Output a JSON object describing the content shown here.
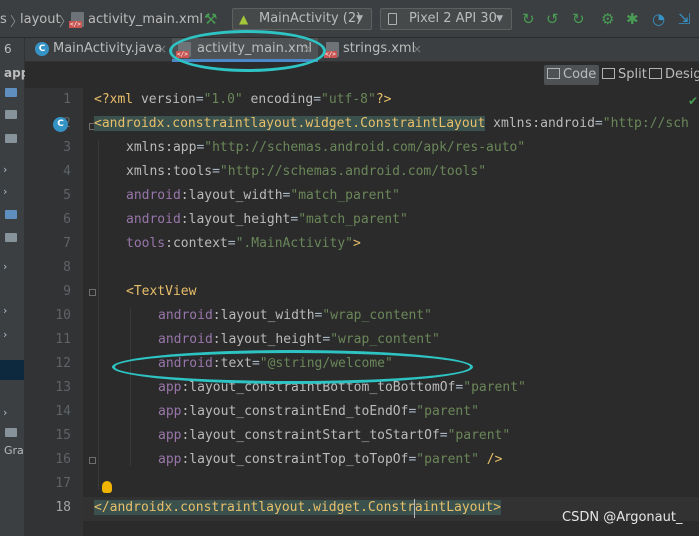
{
  "nav": {
    "crumb_left": "s",
    "crumb_layout": "layout",
    "crumb_file": "activity_main.xml",
    "run_config": "MainActivity (2)",
    "device": "Pixel 2 API 30"
  },
  "project_panel": {
    "top_label": "6",
    "root_label": "app",
    "gradle_label": "Gra"
  },
  "tabs": [
    {
      "label": "MainActivity.java",
      "close": "×"
    },
    {
      "label": "activity_main.xml",
      "close": "×"
    },
    {
      "label": "strings.xml",
      "close": "×"
    }
  ],
  "view_modes": {
    "code": "Code",
    "split": "Split",
    "design": "Desig"
  },
  "gutter": {
    "lines": [
      "1",
      "2",
      "3",
      "4",
      "5",
      "6",
      "7",
      "8",
      "9",
      "10",
      "11",
      "12",
      "13",
      "14",
      "15",
      "16",
      "17",
      "18"
    ],
    "class_marker": "C"
  },
  "code": {
    "l1_open": "<?xml ",
    "l1_a1": "version",
    "l1_eq1": "=",
    "l1_v1": "\"1.0\"",
    "l1_a2": " encoding",
    "l1_eq2": "=",
    "l1_v2": "\"utf-8\"",
    "l1_close": "?>",
    "l2_tag": "<androidx.constraintlayout.widget.ConstraintLayout",
    "l2_ns": " xmlns:android",
    "l2_eq": "=",
    "l2_val": "\"http://sch",
    "l3_ns": "xmlns:app",
    "l3_eq": "=",
    "l3_val": "\"http://schemas.android.com/apk/res-auto\"",
    "l4_ns": "xmlns:tools",
    "l4_eq": "=",
    "l4_val": "\"http://schemas.android.com/tools\"",
    "l5_ns": "android",
    "l5_attr": ":layout_width",
    "l5_eq": "=",
    "l5_val": "\"match_parent\"",
    "l6_ns": "android",
    "l6_attr": ":layout_height",
    "l6_eq": "=",
    "l6_val": "\"match_parent\"",
    "l7_ns": "tools",
    "l7_attr": ":context",
    "l7_eq": "=",
    "l7_val": "\".MainActivity\"",
    "l7_close": ">",
    "l9_tag": "<TextView",
    "l10_ns": "android",
    "l10_attr": ":layout_width",
    "l10_eq": "=",
    "l10_val": "\"wrap_content\"",
    "l11_ns": "android",
    "l11_attr": ":layout_height",
    "l11_eq": "=",
    "l11_val": "\"wrap_content\"",
    "l12_ns": "android",
    "l12_attr": ":text",
    "l12_eq": "=",
    "l12_val": "\"@string/welcome\"",
    "l13_ns": "app",
    "l13_attr": ":layout_constraintBottom_toBottomOf",
    "l13_eq": "=",
    "l13_val": "\"parent\"",
    "l14_ns": "app",
    "l14_attr": ":layout_constraintEnd_toEndOf",
    "l14_eq": "=",
    "l14_val": "\"parent\"",
    "l15_ns": "app",
    "l15_attr": ":layout_constraintStart_toStartOf",
    "l15_eq": "=",
    "l15_val": "\"parent\"",
    "l16_ns": "app",
    "l16_attr": ":layout_constraintTop_toTopOf",
    "l16_eq": "=",
    "l16_val": "\"parent\"",
    "l16_close": " />",
    "l18_tag": "</androidx.constraintlayout.widget.ConstraintLayout>"
  },
  "watermark": "CSDN @Argonaut_",
  "colors": {
    "annotation_ellipse": "#2ec4c4",
    "tag": "#e8bf6a",
    "namespace": "#9876aa",
    "string_value": "#6a8759"
  },
  "icons": [
    "hammer-icon",
    "android-icon",
    "device-icon",
    "rerun-icon",
    "apply-changes-icon",
    "apply-code-icon",
    "run-icon",
    "debug-icon",
    "profile-icon",
    "attach-icon",
    "class-icon",
    "xml-file-icon",
    "lightbulb-icon",
    "check-icon"
  ]
}
